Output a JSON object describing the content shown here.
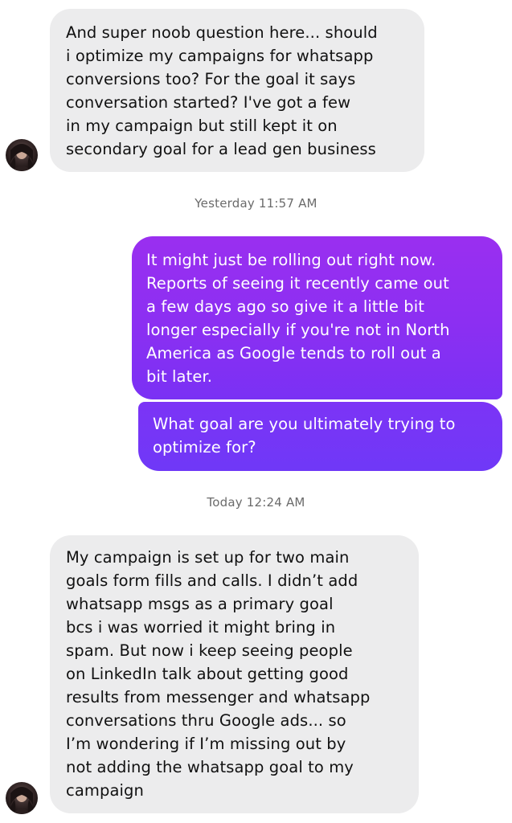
{
  "messages": [
    {
      "text": "And super noob question here... should\ni optimize my campaigns for whatsapp\nconversions too? For the goal it says\nconversation started? I've got a few\nin my campaign but still kept it on\nsecondary goal for a lead gen business"
    },
    {
      "text": "It might just be rolling out right now.\nReports of seeing it recently came out\na few days ago so give it a little bit\nlonger especially if you're not in North\nAmerica as Google tends to roll out a\nbit later."
    },
    {
      "text": "What goal are you ultimately trying to\noptimize for?"
    },
    {
      "text": "My campaign is set up for two main\ngoals form fills and calls. I didn’t add\nwhatsapp msgs as a primary goal\nbcs i was worried it might bring in\nspam. But now i keep seeing people\non LinkedIn talk about getting good\nresults from messenger and whatsapp\nconversations thru Google ads... so\nI’m wondering if I’m missing out by\nnot adding the whatsapp goal to my\ncampaign"
    }
  ],
  "timestamps": {
    "first": "Yesterday 11:57 AM",
    "second": "Today 12:24 AM"
  },
  "colors": {
    "incoming_bubble": "#ececed",
    "outgoing_gradient_start": "#9a2ff0",
    "outgoing_gradient_end": "#6f38f7",
    "timestamp_text": "#6b6b6b"
  },
  "icons": {
    "avatar": "contact-avatar"
  }
}
